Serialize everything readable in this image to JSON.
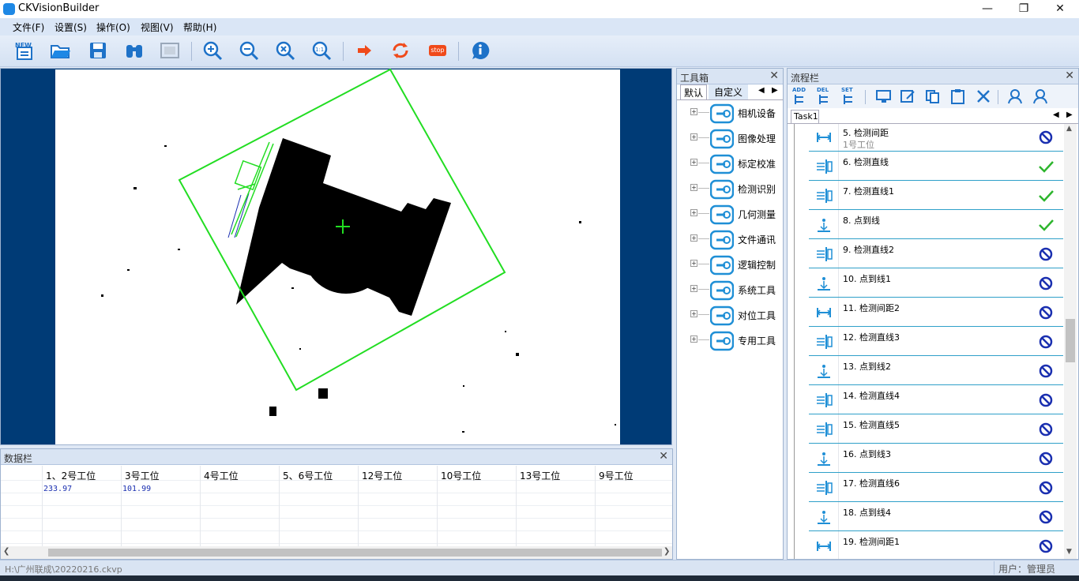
{
  "app": {
    "title": "CKVisionBuilder"
  },
  "window": {
    "minimize": "—",
    "restore": "❐",
    "close": "✕"
  },
  "menu": [
    "文件(F)",
    "设置(S)",
    "操作(O)",
    "视图(V)",
    "帮助(H)"
  ],
  "toolbar": {
    "new": "new-icon",
    "open": "open-folder-icon",
    "save": "save-icon",
    "zoom_in": "zoom-in-icon",
    "zoom_out": "zoom-out-icon",
    "zoom_fit": "zoom-fit-icon",
    "zoom_1to1": "1:1",
    "run": "run-arrow-icon",
    "loop": "loop-icon",
    "stop": "stop",
    "help": "help-icon"
  },
  "data_panel": {
    "title": "数据栏",
    "columns": [
      "1、2号工位",
      "3号工位",
      "4号工位",
      "5、6号工位",
      "12号工位",
      "10号工位",
      "13号工位",
      "9号工位"
    ],
    "values": [
      "233.97",
      "101.99",
      "",
      "",
      "",
      "",
      "",
      ""
    ]
  },
  "toolbox": {
    "title": "工具箱",
    "tabs": [
      "默认",
      "自定义"
    ],
    "items": [
      "相机设备",
      "图像处理",
      "标定校准",
      "检测识别",
      "几何测量",
      "文件通讯",
      "逻辑控制",
      "系统工具",
      "对位工具",
      "专用工具"
    ]
  },
  "flow": {
    "title": "流程栏",
    "tool_labels": [
      "ADD",
      "DEL",
      "SET"
    ],
    "task_tab": "Task1",
    "rows": [
      {
        "label": "5. 检测间距",
        "sub": "1号工位",
        "icon": "distance",
        "status": "disabled"
      },
      {
        "label": "6. 检测直线",
        "sub": "",
        "icon": "line",
        "status": "ok"
      },
      {
        "label": "7. 检测直线1",
        "sub": "",
        "icon": "line",
        "status": "ok"
      },
      {
        "label": "8. 点到线",
        "sub": "",
        "icon": "point",
        "status": "ok"
      },
      {
        "label": "9. 检测直线2",
        "sub": "",
        "icon": "line",
        "status": "disabled"
      },
      {
        "label": "10. 点到线1",
        "sub": "",
        "icon": "point",
        "status": "disabled"
      },
      {
        "label": "11. 检测间距2",
        "sub": "",
        "icon": "distance",
        "status": "disabled"
      },
      {
        "label": "12. 检测直线3",
        "sub": "",
        "icon": "line",
        "status": "disabled"
      },
      {
        "label": "13. 点到线2",
        "sub": "",
        "icon": "point",
        "status": "disabled"
      },
      {
        "label": "14. 检测直线4",
        "sub": "",
        "icon": "line",
        "status": "disabled"
      },
      {
        "label": "15. 检测直线5",
        "sub": "",
        "icon": "line",
        "status": "disabled"
      },
      {
        "label": "16. 点到线3",
        "sub": "",
        "icon": "point",
        "status": "disabled"
      },
      {
        "label": "17. 检测直线6",
        "sub": "",
        "icon": "line",
        "status": "disabled"
      },
      {
        "label": "18. 点到线4",
        "sub": "",
        "icon": "point",
        "status": "disabled"
      },
      {
        "label": "19. 检测间距1",
        "sub": "",
        "icon": "distance",
        "status": "disabled"
      }
    ]
  },
  "status": {
    "file": "H:\\广州联成\\20220216.ckvp",
    "user": "用户：管理员"
  },
  "colors": {
    "accent": "#1f8fd6",
    "roi": "#22dd22",
    "ok": "#2db52d",
    "disabled": "#1a2fb0"
  }
}
